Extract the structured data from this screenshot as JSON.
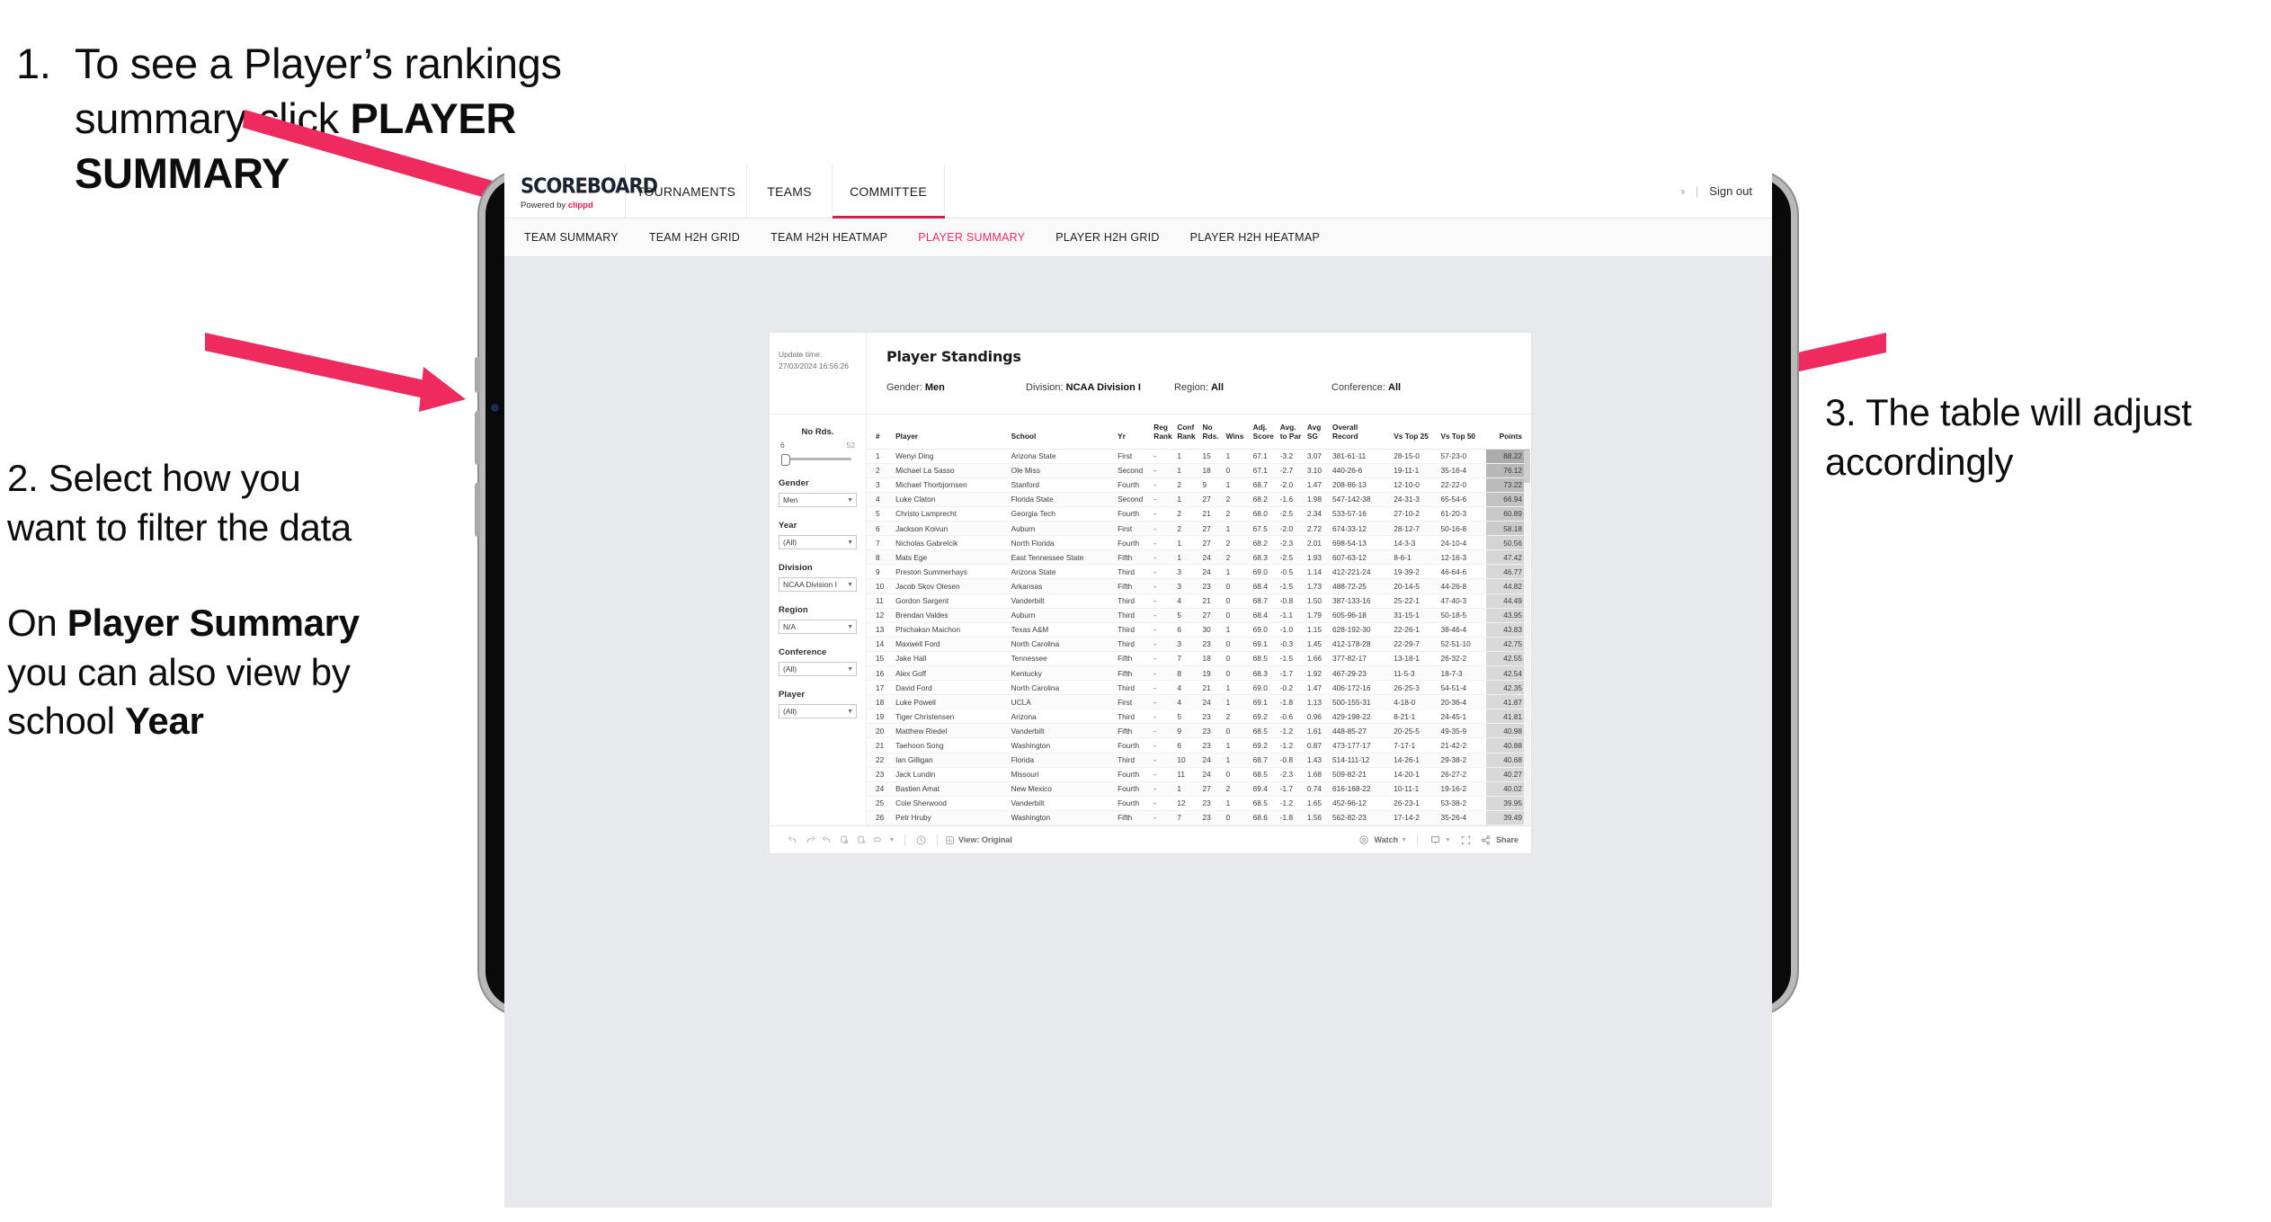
{
  "slide": {
    "annotations": [
      {
        "id": 1,
        "number": "1.",
        "line1": "To see a Player’s rankings",
        "line2_pre": "summary click ",
        "line2_bold": "PLAYER",
        "line3_bold": "SUMMARY"
      },
      {
        "id": 2,
        "number": "2. ",
        "p1": "Select how you want to filter the data",
        "p2_pre": "On ",
        "p2_b1": "Player Summary",
        "p2_mid": " you can also view by school ",
        "p2_b2": "Year"
      },
      {
        "id": 3,
        "text": "3. The table will adjust accordingly"
      }
    ],
    "accent_color": "#ef2a5f"
  },
  "app": {
    "brand": {
      "name": "SCOREBOARD",
      "powered_prefix": "Powered by ",
      "powered_brand": "clippd"
    },
    "topnav": [
      {
        "label": "TOURNAMENTS",
        "active": false
      },
      {
        "label": "TEAMS",
        "active": false
      },
      {
        "label": "COMMITTEE",
        "active": true
      }
    ],
    "account": {
      "chevron": "›",
      "separator": "|",
      "signout": "Sign out"
    },
    "subnav": [
      {
        "label": "TEAM SUMMARY",
        "active": false
      },
      {
        "label": "TEAM H2H GRID",
        "active": false
      },
      {
        "label": "TEAM H2H HEATMAP",
        "active": false
      },
      {
        "label": "PLAYER SUMMARY",
        "active": true
      },
      {
        "label": "PLAYER H2H GRID",
        "active": false
      },
      {
        "label": "PLAYER H2H HEATMAP",
        "active": false
      }
    ],
    "dashboard": {
      "update_label": "Update time:",
      "update_value": "27/03/2024 16:56:26",
      "title": "Player Standings",
      "filter_summary": [
        {
          "label": "Gender:",
          "value": "Men"
        },
        {
          "label": "Division:",
          "value": "NCAA Division I"
        },
        {
          "label": "Region:",
          "value": "All"
        },
        {
          "label": "Conference:",
          "value": "All"
        }
      ],
      "rail": {
        "slider": {
          "title": "No Rds.",
          "min": "6",
          "max": "52",
          "value": 6
        },
        "selects": [
          {
            "label": "Gender",
            "value": "Men"
          },
          {
            "label": "Year",
            "value": "(All)"
          },
          {
            "label": "Division",
            "value": "NCAA Division I"
          },
          {
            "label": "Region",
            "value": "N/A"
          },
          {
            "label": "Conference",
            "value": "(All)"
          },
          {
            "label": "Player",
            "value": "(All)"
          }
        ]
      },
      "toolbar": {
        "view_label": "View: Original",
        "watch_label": "Watch",
        "share_label": "Share"
      }
    }
  },
  "chart_data": {
    "type": "table",
    "title": "Player Standings",
    "columns": [
      "#",
      "Player",
      "School",
      "Yr",
      "Reg Rank",
      "Conf Rank",
      "No Rds.",
      "Wins",
      "Adj. Score",
      "Avg. to Par",
      "Avg SG",
      "Overall Record",
      "Vs Top 25",
      "Vs Top 50",
      "Points"
    ],
    "rows": [
      [
        "1",
        "Wenyi Ding",
        "Arizona State",
        "First",
        "-",
        "1",
        "15",
        "1",
        "67.1",
        "-3.2",
        "3.07",
        "381-61-11",
        "28-15-0",
        "57-23-0",
        "88.22"
      ],
      [
        "2",
        "Michael La Sasso",
        "Ole Miss",
        "Second",
        "-",
        "1",
        "18",
        "0",
        "67.1",
        "-2.7",
        "3.10",
        "440-26-6",
        "19-11-1",
        "35-16-4",
        "76.12"
      ],
      [
        "3",
        "Michael Thorbjornsen",
        "Stanford",
        "Fourth",
        "-",
        "2",
        "9",
        "1",
        "68.7",
        "-2.0",
        "1.47",
        "208-86-13",
        "12-10-0",
        "22-22-0",
        "73.22"
      ],
      [
        "4",
        "Luke Claton",
        "Florida State",
        "Second",
        "-",
        "1",
        "27",
        "2",
        "68.2",
        "-1.6",
        "1.98",
        "547-142-38",
        "24-31-3",
        "65-54-6",
        "66.94"
      ],
      [
        "5",
        "Christo Lamprecht",
        "Georgia Tech",
        "Fourth",
        "-",
        "2",
        "21",
        "2",
        "68.0",
        "-2.5",
        "2.34",
        "533-57-16",
        "27-10-2",
        "61-20-3",
        "60.89"
      ],
      [
        "6",
        "Jackson Koivun",
        "Auburn",
        "First",
        "-",
        "2",
        "27",
        "1",
        "67.5",
        "-2.0",
        "2.72",
        "674-33-12",
        "28-12-7",
        "50-16-8",
        "58.18"
      ],
      [
        "7",
        "Nicholas Gabrelcik",
        "North Florida",
        "Fourth",
        "-",
        "1",
        "27",
        "2",
        "68.2",
        "-2.3",
        "2.01",
        "698-54-13",
        "14-3-3",
        "24-10-4",
        "50.56"
      ],
      [
        "8",
        "Mats Ege",
        "East Tennessee State",
        "Fifth",
        "-",
        "1",
        "24",
        "2",
        "68.3",
        "-2.5",
        "1.93",
        "607-63-12",
        "8-6-1",
        "12-16-3",
        "47.42"
      ],
      [
        "9",
        "Preston Summerhays",
        "Arizona State",
        "Third",
        "-",
        "3",
        "24",
        "1",
        "69.0",
        "-0.5",
        "1.14",
        "412-221-24",
        "19-39-2",
        "46-64-6",
        "46.77"
      ],
      [
        "10",
        "Jacob Skov Olesen",
        "Arkansas",
        "Fifth",
        "-",
        "3",
        "23",
        "0",
        "68.4",
        "-1.5",
        "1.73",
        "488-72-25",
        "20-14-5",
        "44-26-8",
        "44.82"
      ],
      [
        "11",
        "Gordon Sargent",
        "Vanderbilt",
        "Third",
        "-",
        "4",
        "21",
        "0",
        "68.7",
        "-0.8",
        "1.50",
        "387-133-16",
        "25-22-1",
        "47-40-3",
        "44.49"
      ],
      [
        "12",
        "Brendan Valdes",
        "Auburn",
        "Third",
        "-",
        "5",
        "27",
        "0",
        "68.4",
        "-1.1",
        "1.79",
        "605-96-18",
        "31-15-1",
        "50-18-5",
        "43.95"
      ],
      [
        "13",
        "Phichaksn Maichon",
        "Texas A&M",
        "Third",
        "-",
        "6",
        "30",
        "1",
        "69.0",
        "-1.0",
        "1.15",
        "628-192-30",
        "22-26-1",
        "38-46-4",
        "43.83"
      ],
      [
        "14",
        "Maxwell Ford",
        "North Carolina",
        "Third",
        "-",
        "3",
        "23",
        "0",
        "69.1",
        "-0.3",
        "1.45",
        "412-178-28",
        "22-29-7",
        "52-51-10",
        "42.75"
      ],
      [
        "15",
        "Jake Hall",
        "Tennessee",
        "Fifth",
        "-",
        "7",
        "18",
        "0",
        "68.5",
        "-1.5",
        "1.66",
        "377-82-17",
        "13-18-1",
        "26-32-2",
        "42.55"
      ],
      [
        "16",
        "Alex Goff",
        "Kentucky",
        "Fifth",
        "-",
        "8",
        "19",
        "0",
        "68.3",
        "-1.7",
        "1.92",
        "467-29-23",
        "11-5-3",
        "18-7-3",
        "42.54"
      ],
      [
        "17",
        "David Ford",
        "North Carolina",
        "Third",
        "-",
        "4",
        "21",
        "1",
        "69.0",
        "-0.2",
        "1.47",
        "406-172-16",
        "26-25-3",
        "54-51-4",
        "42.35"
      ],
      [
        "18",
        "Luke Powell",
        "UCLA",
        "First",
        "-",
        "4",
        "24",
        "1",
        "69.1",
        "-1.8",
        "1.13",
        "500-155-31",
        "4-18-0",
        "20-36-4",
        "41.87"
      ],
      [
        "19",
        "Tiger Christensen",
        "Arizona",
        "Third",
        "-",
        "5",
        "23",
        "2",
        "69.2",
        "-0.6",
        "0.96",
        "429-198-22",
        "8-21-1",
        "24-45-1",
        "41.81"
      ],
      [
        "20",
        "Matthew Riedel",
        "Vanderbilt",
        "Fifth",
        "-",
        "9",
        "23",
        "0",
        "68.5",
        "-1.2",
        "1.61",
        "448-85-27",
        "20-25-5",
        "49-35-9",
        "40.98"
      ],
      [
        "21",
        "Taehoon Song",
        "Washington",
        "Fourth",
        "-",
        "6",
        "23",
        "1",
        "69.2",
        "-1.2",
        "0.87",
        "473-177-17",
        "7-17-1",
        "21-42-2",
        "40.88"
      ],
      [
        "22",
        "Ian Gilligan",
        "Florida",
        "Third",
        "-",
        "10",
        "24",
        "1",
        "68.7",
        "-0.8",
        "1.43",
        "514-111-12",
        "14-26-1",
        "29-38-2",
        "40.68"
      ],
      [
        "23",
        "Jack Lundin",
        "Missouri",
        "Fourth",
        "-",
        "11",
        "24",
        "0",
        "68.5",
        "-2.3",
        "1.68",
        "509-82-21",
        "14-20-1",
        "26-27-2",
        "40.27"
      ],
      [
        "24",
        "Bastien Amat",
        "New Mexico",
        "Fourth",
        "-",
        "1",
        "27",
        "2",
        "69.4",
        "-1.7",
        "0.74",
        "616-168-22",
        "10-11-1",
        "19-16-2",
        "40.02"
      ],
      [
        "25",
        "Cole Sherwood",
        "Vanderbilt",
        "Fourth",
        "-",
        "12",
        "23",
        "1",
        "68.5",
        "-1.2",
        "1.65",
        "452-96-12",
        "26-23-1",
        "53-38-2",
        "39.95"
      ],
      [
        "26",
        "Petr Hruby",
        "Washington",
        "Fifth",
        "-",
        "7",
        "23",
        "0",
        "68.6",
        "-1.8",
        "1.56",
        "562-82-23",
        "17-14-2",
        "35-26-4",
        "39.49"
      ]
    ],
    "points_max": 88.22,
    "points_min": 39.49
  }
}
